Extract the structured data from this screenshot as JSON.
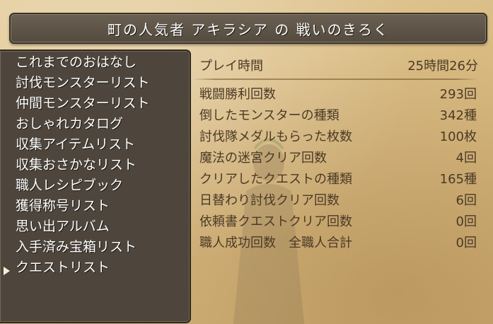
{
  "title": "町の人気者 アキラシア の 戦いのきろく",
  "menu": [
    {
      "label": "これまでのおはなし"
    },
    {
      "label": "討伐モンスターリスト"
    },
    {
      "label": "仲間モンスターリスト"
    },
    {
      "label": "おしゃれカタログ"
    },
    {
      "label": "収集アイテムリスト"
    },
    {
      "label": "収集おさかなリスト"
    },
    {
      "label": "職人レシピブック"
    },
    {
      "label": "獲得称号リスト"
    },
    {
      "label": "思い出アルバム"
    },
    {
      "label": "入手済み宝箱リスト"
    },
    {
      "label": "クエストリスト"
    }
  ],
  "selected_menu_index": 10,
  "playtime": {
    "label": "プレイ時間",
    "value": "25時間26分"
  },
  "stats": [
    {
      "label": "戦闘勝利回数",
      "value": "293回"
    },
    {
      "label": "倒したモンスターの種類",
      "value": "342種"
    },
    {
      "label": "討伐隊メダルもらった枚数",
      "value": "100枚"
    },
    {
      "label": "魔法の迷宮クリア回数",
      "value": "4回"
    },
    {
      "label": "クリアしたクエストの種類",
      "value": "165種"
    },
    {
      "label": "日替わり討伐クリア回数",
      "value": "6回"
    },
    {
      "label": "依頼書クエストクリア回数",
      "value": "0回"
    },
    {
      "label": "職人成功回数　全職人合計",
      "value": "0回"
    }
  ],
  "colors": {
    "parchment": "#d9bb82",
    "panel": "#4e463c",
    "title_bar": "#5e5548",
    "stat_text": "#4b3a26",
    "menu_text": "#ffffff"
  },
  "icons": [
    "cursor-arrow-icon"
  ]
}
